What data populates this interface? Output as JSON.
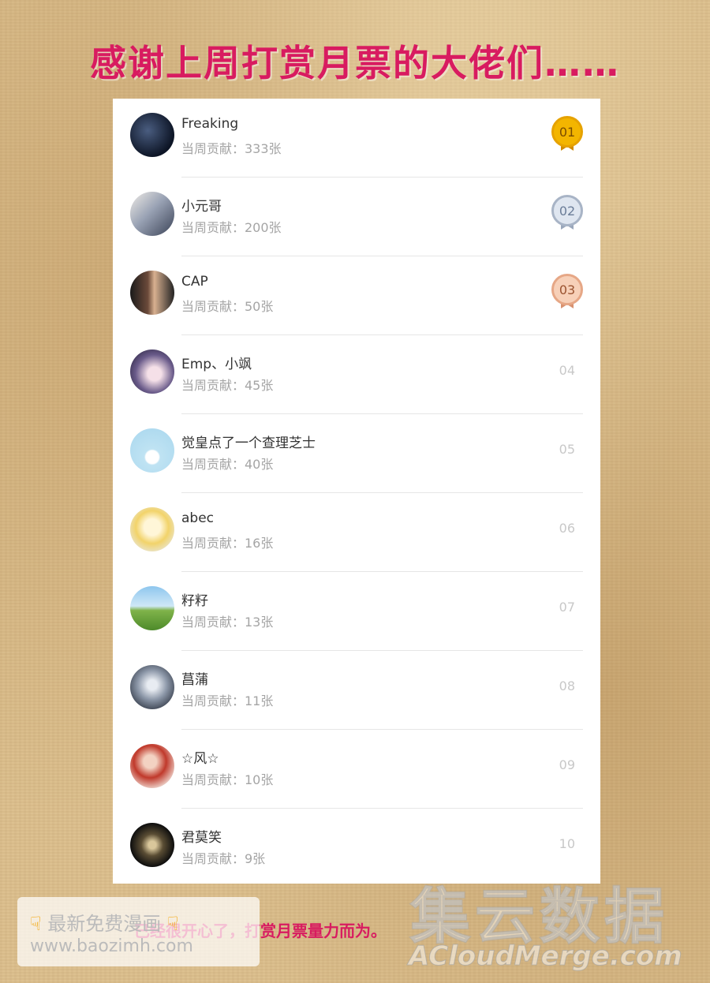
{
  "header": {
    "title": "感谢上周打赏月票的大佬们……"
  },
  "contribution_prefix": "当周贡献：",
  "ranking": [
    {
      "rank": "01",
      "name": "Freaking",
      "contribution": "当周贡献：333张",
      "medal": "gold"
    },
    {
      "rank": "02",
      "name": "小元哥",
      "contribution": "当周贡献：200张",
      "medal": "silver"
    },
    {
      "rank": "03",
      "name": "CAP",
      "contribution": "当周贡献：50张",
      "medal": "bronze"
    },
    {
      "rank": "04",
      "name": "Emp、小飒",
      "contribution": "当周贡献：45张"
    },
    {
      "rank": "05",
      "name": "觉皇点了一个查理芝士",
      "contribution": "当周贡献：40张"
    },
    {
      "rank": "06",
      "name": "abec",
      "contribution": "当周贡献：16张"
    },
    {
      "rank": "07",
      "name": "籽籽",
      "contribution": "当周贡献：13张"
    },
    {
      "rank": "08",
      "name": "菖蒲",
      "contribution": "当周贡献：11张"
    },
    {
      "rank": "09",
      "name": "☆风☆",
      "contribution": "当周贡献：10张"
    },
    {
      "rank": "10",
      "name": "君莫笑",
      "contribution": "当周贡献：9张"
    }
  ],
  "footer": {
    "text": "已经很开心了，打赏月票量力而为。"
  },
  "watermarks": {
    "baozi_line1": "最新免费漫画",
    "baozi_line2": "www.baozimh.com",
    "acloud_cn": "集云数据",
    "acloud_en": "ACloudMerge.com"
  }
}
